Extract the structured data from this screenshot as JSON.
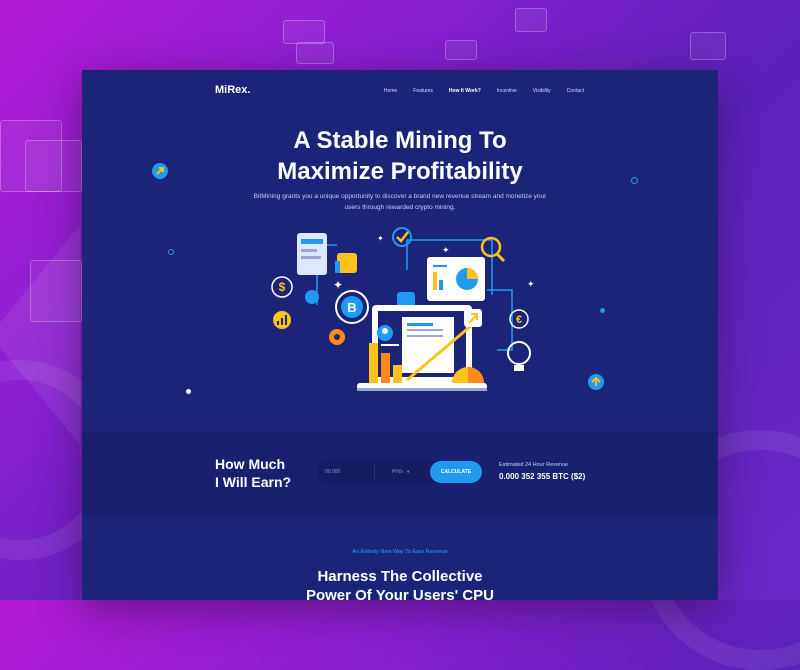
{
  "brand": {
    "logo": "MiRex."
  },
  "nav": {
    "links": [
      "Home",
      "Features",
      "How It Work?",
      "Incentive",
      "Visibility",
      "Contact"
    ]
  },
  "hero": {
    "title_line1": "A Stable Mining To",
    "title_line2": "Maximize Profitability",
    "subtitle": "BitMining grants you a unique opportunity to discover a brand new revenue stream and monetize your users through rewarded crypto mining."
  },
  "earn": {
    "title_line1": "How Much",
    "title_line2": "I Will Earn?",
    "input_placeholder": "00.000",
    "unit": "PH/s",
    "button": "CALCULATE",
    "estimate_label": "Estimated 24 Hour Revenue",
    "estimate_value": "0.000 352 355 BTC ($2)"
  },
  "lower": {
    "tag": "An Entirely New Way To Earn Revenue",
    "title_line1": "Harness The Collective",
    "title_line2": "Power Of Your Users' CPU"
  },
  "colors": {
    "page_bg": "#1c247a",
    "accent_blue": "#1e9bf0",
    "accent_yellow": "#ffc21a",
    "accent_orange": "#ff8a1a"
  }
}
